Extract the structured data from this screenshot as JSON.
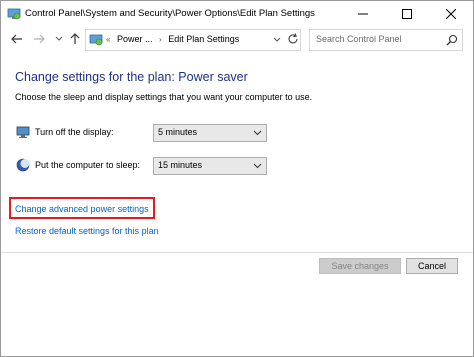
{
  "window": {
    "title": "Control Panel\\System and Security\\Power Options\\Edit Plan Settings"
  },
  "address_bar": {
    "crumb_prefix": "«",
    "crumbs": [
      "Power ...",
      "Edit Plan Settings"
    ]
  },
  "search": {
    "placeholder": "Search Control Panel"
  },
  "main": {
    "heading": "Change settings for the plan: Power saver",
    "subtext": "Choose the sleep and display settings that you want your computer to use.",
    "settings": [
      {
        "label": "Turn off the display:",
        "value": "5 minutes",
        "icon": "monitor-icon"
      },
      {
        "label": "Put the computer to sleep:",
        "value": "15 minutes",
        "icon": "moon-icon"
      }
    ],
    "links": {
      "advanced": "Change advanced power settings",
      "restore": "Restore default settings for this plan"
    }
  },
  "buttons": {
    "save": "Save changes",
    "cancel": "Cancel"
  },
  "colors": {
    "heading": "#1e3287",
    "link": "#0066cc",
    "highlight": "#e31c23"
  }
}
